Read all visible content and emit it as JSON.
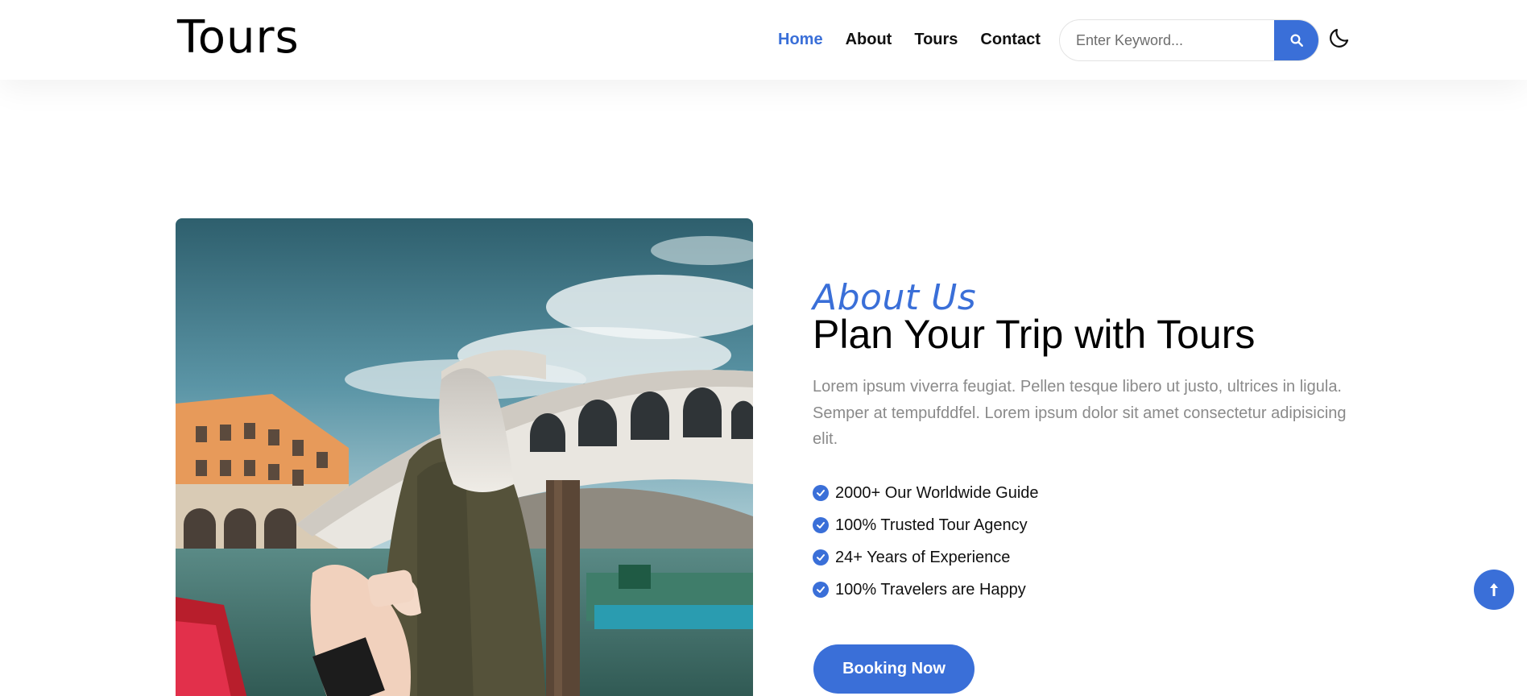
{
  "brand": {
    "logo_text": "Tours"
  },
  "nav": {
    "items": [
      {
        "label": "Home",
        "active": true
      },
      {
        "label": "About",
        "active": false
      },
      {
        "label": "Tours",
        "active": false
      },
      {
        "label": "Contact",
        "active": false
      }
    ]
  },
  "search": {
    "placeholder": "Enter Keyword...",
    "value": "",
    "icon": "search-icon"
  },
  "theme_toggle": {
    "icon": "moon-icon"
  },
  "about": {
    "subtitle": "About Us",
    "title": "Plan Your Trip with Tours",
    "description": "Lorem ipsum viverra feugiat. Pellen tesque libero ut justo, ultrices in ligula. Semper at tempufddfel. Lorem ipsum dolor sit amet consectetur adipisicing elit.",
    "features": [
      "2000+ Our Worldwide Guide",
      "100% Trusted Tour Agency",
      "24+ Years of Experience",
      "100% Travelers are Happy"
    ],
    "cta_label": "Booking Now"
  },
  "scroll_top": {
    "icon": "arrow-up-icon"
  },
  "colors": {
    "accent": "#3a6fd8",
    "text_muted": "#8a8a8a",
    "text_dark": "#111111"
  }
}
